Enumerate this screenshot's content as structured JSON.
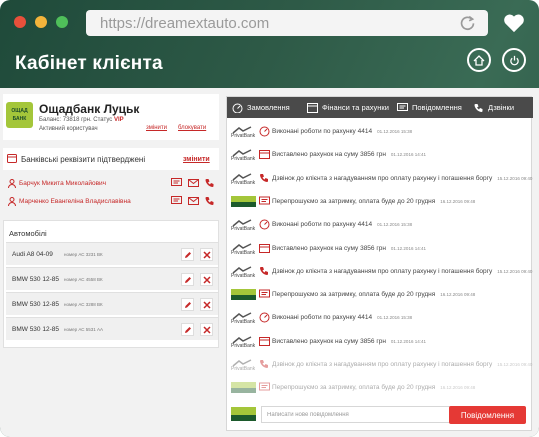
{
  "browser": {
    "url": "https://dreamextauto.com"
  },
  "header": {
    "title": "Кабінет клієнта"
  },
  "bank": {
    "logo_text": "ОЩАД БАНК",
    "name": "Ощадбанк Луцьк",
    "balance_line": "Баланс: 73818 грн.  Статус",
    "status": "VIP",
    "user_type": "Активний користувач",
    "change_link": "змінити",
    "block_link": "блокувати"
  },
  "requisites": {
    "text": "Банківські реквізити підтверджені",
    "change_link": "змінити"
  },
  "persons": [
    {
      "name": "Барчук Микита Миколайович"
    },
    {
      "name": "Марченко Евангеліна Владиславівна"
    }
  ],
  "cars": {
    "header": "Автомобілі",
    "rows": [
      {
        "model": "Audi A8 04-09",
        "number": "номер АС 3231 ВК"
      },
      {
        "model": "BMW 530 12-85",
        "number": "номер АС 4558 ВК"
      },
      {
        "model": "BMW 530 12-85",
        "number": "номер АС 3288 ВК"
      },
      {
        "model": "BMW 530 12-85",
        "number": "номер АС 5531 АА"
      }
    ]
  },
  "tabs": [
    {
      "label": "Замовлення",
      "icon": "speedometer-icon"
    },
    {
      "label": "Фінанси та рахунки",
      "icon": "finance-icon"
    },
    {
      "label": "Повідомлення",
      "icon": "message-icon"
    },
    {
      "label": "Дзвінки",
      "icon": "phone-icon"
    }
  ],
  "messages": [
    {
      "logo": "PrivatBank",
      "icon": "speedometer-icon",
      "text": "Виконані роботи по рахунку 4414",
      "time": "01.12.2016 15:38"
    },
    {
      "logo": "PrivatBank",
      "icon": "finance-icon",
      "text": "Виставлено рахунок на суму 3856 грн",
      "time": "01.12.2016 14:41"
    },
    {
      "logo": "PrivatBank",
      "icon": "phone-icon",
      "text": "Дзвінок до клієнта з нагадуванням про оплату рахунку і погашення боргу",
      "time": "15.12.2016 09:40"
    },
    {
      "logo": "Oschadbank",
      "icon": "message-icon",
      "text": "Перепрошуємо за затримку, оплата буде до 20 грудня",
      "time": "16.12.2016 09:48"
    },
    {
      "logo": "PrivatBank",
      "icon": "speedometer-icon",
      "text": "Виконані роботи по рахунку 4414",
      "time": "01.12.2016 15:38"
    },
    {
      "logo": "PrivatBank",
      "icon": "finance-icon",
      "text": "Виставлено рахунок на суму 3856 грн",
      "time": "01.12.2016 14:41"
    },
    {
      "logo": "PrivatBank",
      "icon": "phone-icon",
      "text": "Дзвінок до клієнта з нагадуванням про оплату рахунку і погашення боргу",
      "time": "15.12.2016 09:40"
    },
    {
      "logo": "Oschadbank",
      "icon": "message-icon",
      "text": "Перепрошуємо за затримку, оплата буде до 20 грудня",
      "time": "16.12.2016 09:48"
    },
    {
      "logo": "PrivatBank",
      "icon": "speedometer-icon",
      "text": "Виконані роботи по рахунку 4414",
      "time": "01.12.2016 15:38"
    },
    {
      "logo": "PrivatBank",
      "icon": "finance-icon",
      "text": "Виставлено рахунок на суму 3856 грн",
      "time": "01.12.2016 14:41"
    },
    {
      "logo": "PrivatBank",
      "icon": "phone-icon",
      "text": "Дзвінок до клієнта з нагадуванням про оплату рахунку і погашення боргу",
      "time": "15.12.2016 09:40"
    },
    {
      "logo": "Oschadbank",
      "icon": "message-icon",
      "text": "Перепрошуємо за затримку, оплата буде до 20 грудня",
      "time": "16.12.2016 09:48"
    }
  ],
  "compose": {
    "placeholder": "Написати нове повідомлення",
    "send_label": "Повідомлення"
  },
  "colors": {
    "accent": "#e53935",
    "header_green": "#2e5a47",
    "tab_dark": "#4a4a4a"
  }
}
